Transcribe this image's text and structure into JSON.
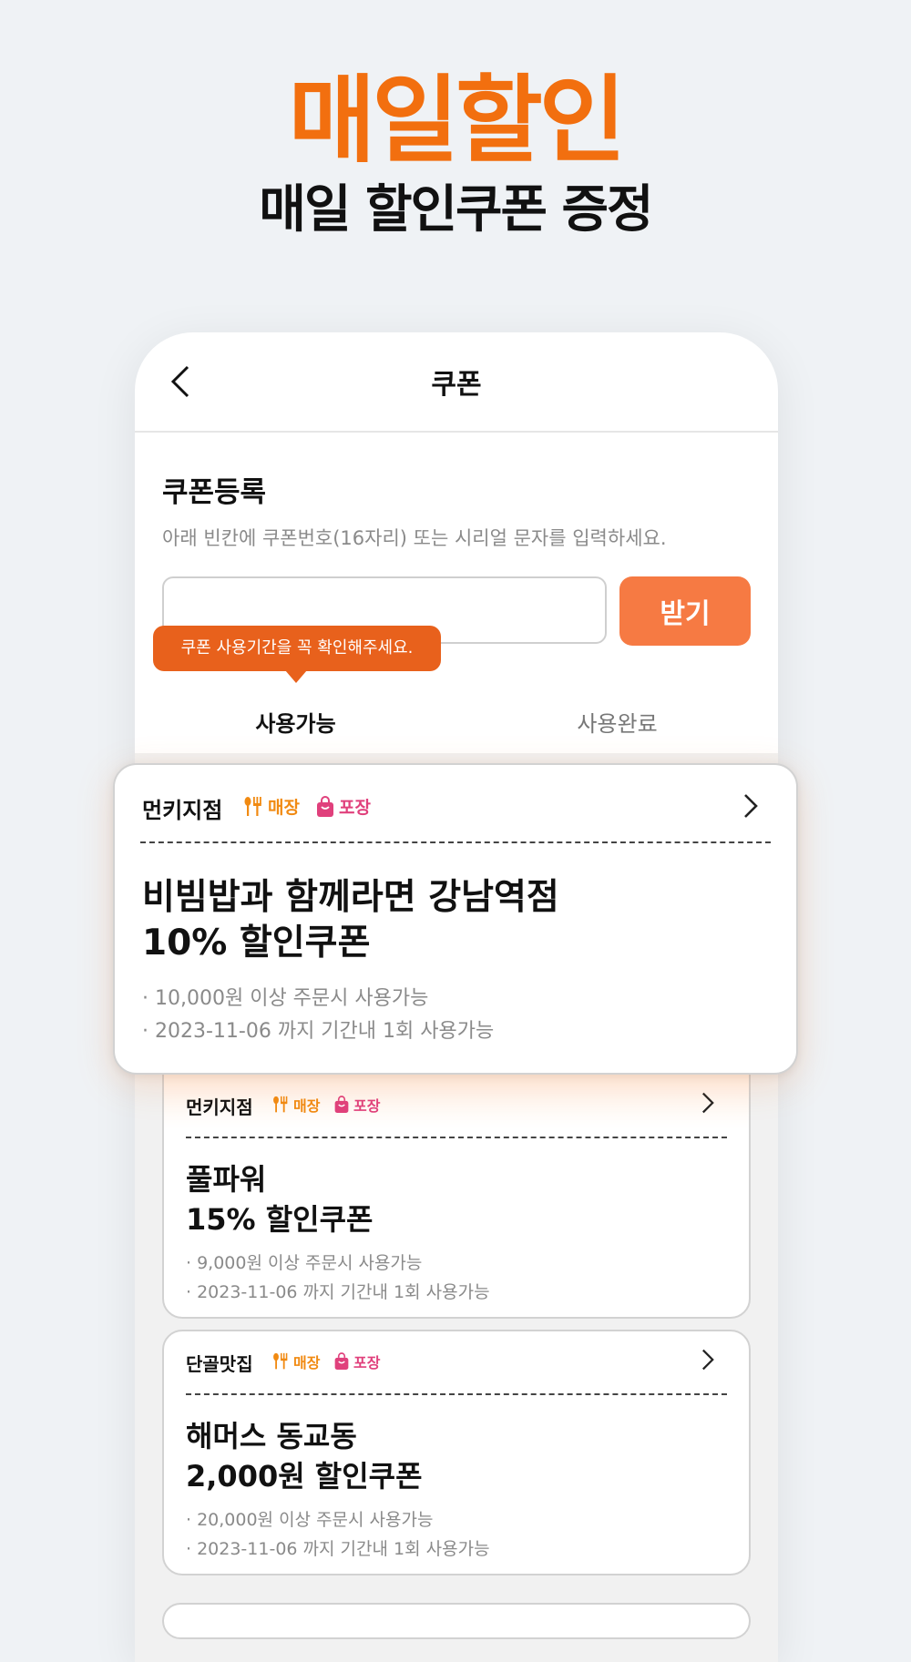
{
  "promo": {
    "headline": "매일할인",
    "subline": "매일 할인쿠폰 증정"
  },
  "screen": {
    "title": "쿠폰"
  },
  "register": {
    "title": "쿠폰등록",
    "description": "아래 빈칸에 쿠폰번호(16자리) 또는 시리얼 문자를 입력하세요.",
    "input_value": "",
    "input_placeholder": "",
    "button_label": "받기",
    "tooltip": "쿠폰 사용기간을 꼭 확인해주세요."
  },
  "tabs": [
    {
      "label": "사용가능",
      "active": true
    },
    {
      "label": "사용완료",
      "active": false
    }
  ],
  "tags": {
    "dine_in": "매장",
    "takeout": "포장"
  },
  "coupons": [
    {
      "store": "먼키지점",
      "name_line1": "비빔밥과 함께라면 강남역점",
      "name_line2": "10% 할인쿠폰",
      "condition": "· 10,000원 이상 주문시 사용가능",
      "validity": "· 2023-11-06 까지 기간내 1회 사용가능"
    },
    {
      "store": "먼키지점",
      "name_line1": "풀파워",
      "name_line2": "15% 할인쿠폰",
      "condition": "· 9,000원 이상 주문시 사용가능",
      "validity": "· 2023-11-06 까지 기간내 1회 사용가능"
    },
    {
      "store": "단골맛집",
      "name_line1": "해머스 동교동",
      "name_line2": "2,000원 할인쿠폰",
      "condition": "· 20,000원 이상 주문시 사용가능",
      "validity": "· 2023-11-06 까지 기간내 1회 사용가능"
    }
  ],
  "colors": {
    "accent": "#f26f0f",
    "button": "#f67a43",
    "tooltip": "#e8611c",
    "dine_in_tag": "#f18a12",
    "takeout_tag": "#e0407c"
  },
  "icons": [
    "back-arrow-icon",
    "fork-spoon-icon",
    "shopping-bag-icon",
    "chevron-right-icon"
  ]
}
